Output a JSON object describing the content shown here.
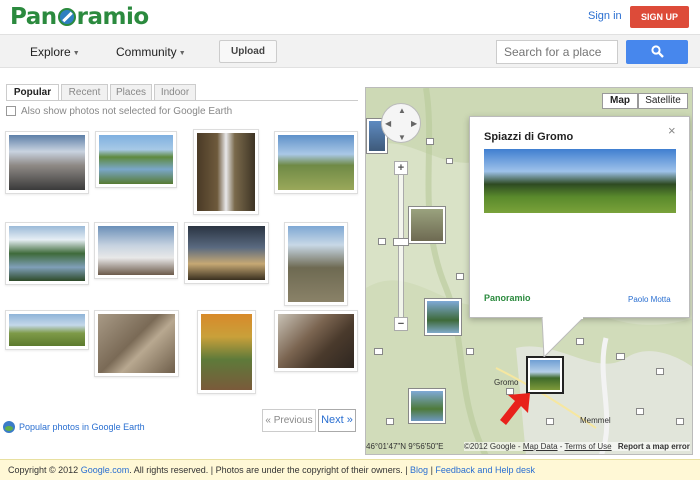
{
  "header": {
    "logo_text_1": "Pan",
    "logo_text_2": "ramio",
    "sign_in": "Sign in",
    "sign_up": "SIGN UP"
  },
  "nav": {
    "explore": "Explore",
    "community": "Community",
    "upload": "Upload",
    "search_placeholder": "Search for a place"
  },
  "tabs": [
    "Popular",
    "Recent",
    "Places",
    "Indoor"
  ],
  "checkbox_label": "Also show photos not selected for Google Earth",
  "popular_link": "Popular photos in Google Earth",
  "pagination": {
    "previous": "« Previous",
    "next": "Next »"
  },
  "map": {
    "type_map": "Map",
    "type_satellite": "Satellite",
    "info_title": "Spiazzi di Gromo",
    "info_close": "×",
    "info_logo": "Panoramio",
    "info_author": "Paolo Motta",
    "coords": "46°01'47\"N 9°56'50\"E",
    "attrib_copy": "©2012 Google -",
    "attrib_data": "Map Data",
    "attrib_sep": " - ",
    "attrib_terms": "Terms of Use",
    "attrib_report": "Report a map error",
    "label_gromo": "Gromo",
    "label_memmel": "Memmel"
  },
  "footer": {
    "copyright_prefix": "Copyright © 2012 ",
    "google_link": "Google.com",
    "copyright_suffix": ". All rights reserved. | Photos are under the copyright of their owners. | ",
    "blog": "Blog",
    "sep": " | ",
    "feedback": "Feedback and Help desk"
  },
  "colors": {
    "brand_green": "#2b8a3e",
    "link_blue": "#2a6fd1",
    "signup_red": "#dd4b39",
    "search_blue": "#4787ed",
    "footer_bg": "#fff8d6"
  }
}
